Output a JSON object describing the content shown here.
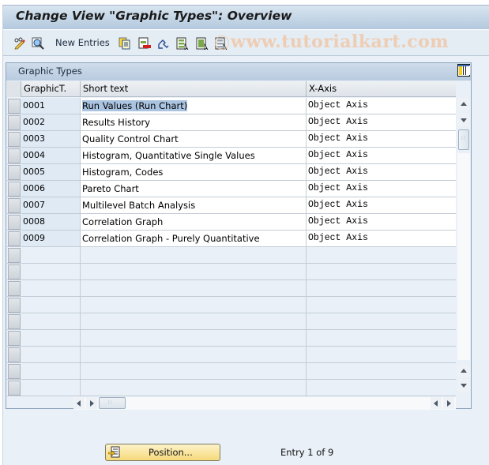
{
  "window": {
    "title": "Change View \"Graphic Types\": Overview"
  },
  "toolbar": {
    "items": [
      {
        "icon": "display-change-icon"
      },
      {
        "icon": "find-icon"
      },
      {
        "label": "New Entries"
      },
      {
        "icon": "copy-as-icon"
      },
      {
        "icon": "delete-icon"
      },
      {
        "icon": "undo-change-icon"
      },
      {
        "icon": "select-all-icon"
      },
      {
        "icon": "select-block-icon"
      },
      {
        "icon": "deselect-all-icon"
      }
    ],
    "new_entries_label": "New Entries",
    "watermark": "www.tutorialkart.com"
  },
  "table": {
    "title": "Graphic Types",
    "columns": [
      "GraphicT.",
      "Short text",
      "X-Axis"
    ],
    "rows": [
      {
        "code": "0001",
        "text": "Run Values (Run Chart)",
        "xaxis": "Object Axis",
        "highlighted": true
      },
      {
        "code": "0002",
        "text": "Results History",
        "xaxis": "Object Axis"
      },
      {
        "code": "0003",
        "text": "Quality Control Chart",
        "xaxis": "Object Axis"
      },
      {
        "code": "0004",
        "text": "Histogram, Quantitative Single Values",
        "xaxis": "Object Axis"
      },
      {
        "code": "0005",
        "text": "Histogram, Codes",
        "xaxis": "Object Axis"
      },
      {
        "code": "0006",
        "text": "Pareto Chart",
        "xaxis": "Object Axis"
      },
      {
        "code": "0007",
        "text": "Multilevel Batch Analysis",
        "xaxis": "Object Axis"
      },
      {
        "code": "0008",
        "text": "Correlation Graph",
        "xaxis": "Object Axis"
      },
      {
        "code": "0009",
        "text": "Correlation Graph - Purely Quantitative",
        "xaxis": "Object Axis"
      }
    ],
    "empty_rows": 9
  },
  "footer": {
    "position_button": "Position...",
    "entry_status": "Entry 1 of 9"
  },
  "colors": {
    "title_bar": "#b3c9de",
    "key_column": "#dfeaf5",
    "selection": "#a9c3e0",
    "position_button": "#f6d97a"
  }
}
